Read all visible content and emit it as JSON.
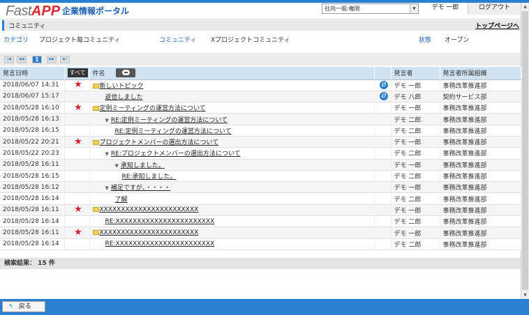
{
  "header": {
    "logo_fast": "Fast",
    "logo_app": "APP",
    "logo_portal": "企業情報ポータル",
    "select_value": "社内一般:権限",
    "user_name": "デモ 一郎",
    "logout_label": "ログアウト"
  },
  "titlebar": {
    "title": "コミュニティ",
    "top_link": "トップページへ"
  },
  "info": {
    "category_label": "カテゴリ",
    "category_value": "プロジェクト毎コミュニティ",
    "community_label": "コミュニティ",
    "community_value": "Xプロジェクトコミュニティ",
    "status_label": "状態",
    "status_value": "オープン"
  },
  "pager": {
    "first": "|◀",
    "prev": "◀◀",
    "page": "1",
    "next": "▶▶",
    "last": "▶|"
  },
  "table": {
    "columns": {
      "date": "発言日時",
      "all": "すべて",
      "subject": "件名",
      "speaker": "発言者",
      "org": "発言者所属組織"
    },
    "rows": [
      {
        "date": "2018/06/07 14:31",
        "star": true,
        "indent": 0,
        "icon": "mail",
        "subject": "新しいトピック",
        "attach": true,
        "speaker": "デモ 一郎",
        "org": "事務改革推進部"
      },
      {
        "date": "2018/06/07 15:17",
        "star": false,
        "indent": 1,
        "icon": "",
        "subject": "返信しました",
        "attach": true,
        "speaker": "デモ 八郎",
        "org": "契約サービス部"
      },
      {
        "date": "2018/05/28 16:10",
        "star": true,
        "indent": 0,
        "icon": "mail",
        "subject": "定例ミーティングの運営方法について",
        "attach": false,
        "speaker": "デモ 一郎",
        "org": "事務改革推進部"
      },
      {
        "date": "2018/05/28 16:13",
        "star": false,
        "indent": 1,
        "icon": "tri",
        "subject": "RE:定例ミーティングの運営方法について",
        "attach": false,
        "speaker": "デモ 二郎",
        "org": "事務改革推進部"
      },
      {
        "date": "2018/05/28 16:15",
        "star": false,
        "indent": 2,
        "icon": "",
        "subject": "RE:定例ミーティングの運営方法について",
        "attach": false,
        "speaker": "デモ 二郎",
        "org": "事務改革推進部"
      },
      {
        "date": "2018/05/22 20:21",
        "star": true,
        "indent": 0,
        "icon": "mail",
        "subject": "プロジェクトメンバーの選出方法について",
        "attach": false,
        "speaker": "デモ 一郎",
        "org": "事務改革推進部"
      },
      {
        "date": "2018/05/22 20:23",
        "star": false,
        "indent": 1,
        "icon": "tri",
        "subject": "RE:プロジェクトメンバーの選出方法について",
        "attach": false,
        "speaker": "デモ 二郎",
        "org": "事務改革推進部"
      },
      {
        "date": "2018/05/28 16:11",
        "star": false,
        "indent": 2,
        "icon": "tri",
        "subject": "承知しました。",
        "attach": false,
        "speaker": "デモ 一郎",
        "org": "事務改革推進部"
      },
      {
        "date": "2018/05/28 16:15",
        "star": false,
        "indent": 3,
        "icon": "",
        "subject": "RE:承知しました。",
        "attach": false,
        "speaker": "デモ 二郎",
        "org": "事務改革推進部"
      },
      {
        "date": "2018/05/28 16:12",
        "star": false,
        "indent": 1,
        "icon": "tri",
        "subject": "補足ですが、・・・・",
        "attach": false,
        "speaker": "デモ 一郎",
        "org": "事務改革推進部"
      },
      {
        "date": "2018/05/28 16:14",
        "star": false,
        "indent": 2,
        "icon": "",
        "subject": "了解",
        "attach": false,
        "speaker": "デモ 二郎",
        "org": "事務改革推進部"
      },
      {
        "date": "2018/05/28 16:11",
        "star": true,
        "indent": 0,
        "icon": "mail",
        "subject": "XXXXXXXXXXXXXXXXXXXXXXX",
        "attach": false,
        "speaker": "デモ 一郎",
        "org": "事務改革推進部"
      },
      {
        "date": "2018/05/28 16:14",
        "star": false,
        "indent": 1,
        "icon": "",
        "subject": "RE:XXXXXXXXXXXXXXXXXXXXXXX",
        "attach": false,
        "speaker": "デモ 二郎",
        "org": "事務改革推進部"
      },
      {
        "date": "2018/05/28 16:11",
        "star": true,
        "indent": 0,
        "icon": "mail",
        "subject": "XXXXXXXXXXXXXXXXXXXXXXX",
        "attach": false,
        "speaker": "デモ 一郎",
        "org": "事務改革推進部"
      },
      {
        "date": "2018/05/28 16:14",
        "star": false,
        "indent": 1,
        "icon": "",
        "subject": "RE:XXXXXXXXXXXXXXXXXXXXXXX",
        "attach": false,
        "speaker": "デモ 二郎",
        "org": "事務改革推進部"
      }
    ]
  },
  "result": {
    "label": "検索結果：",
    "count": "15 件"
  },
  "footer": {
    "back_label": "戻る"
  },
  "colors": {
    "accent": "#2a7fd0",
    "star": "#cc2233",
    "brand_red": "#d9282f",
    "header_row": "#cfe3f3"
  }
}
